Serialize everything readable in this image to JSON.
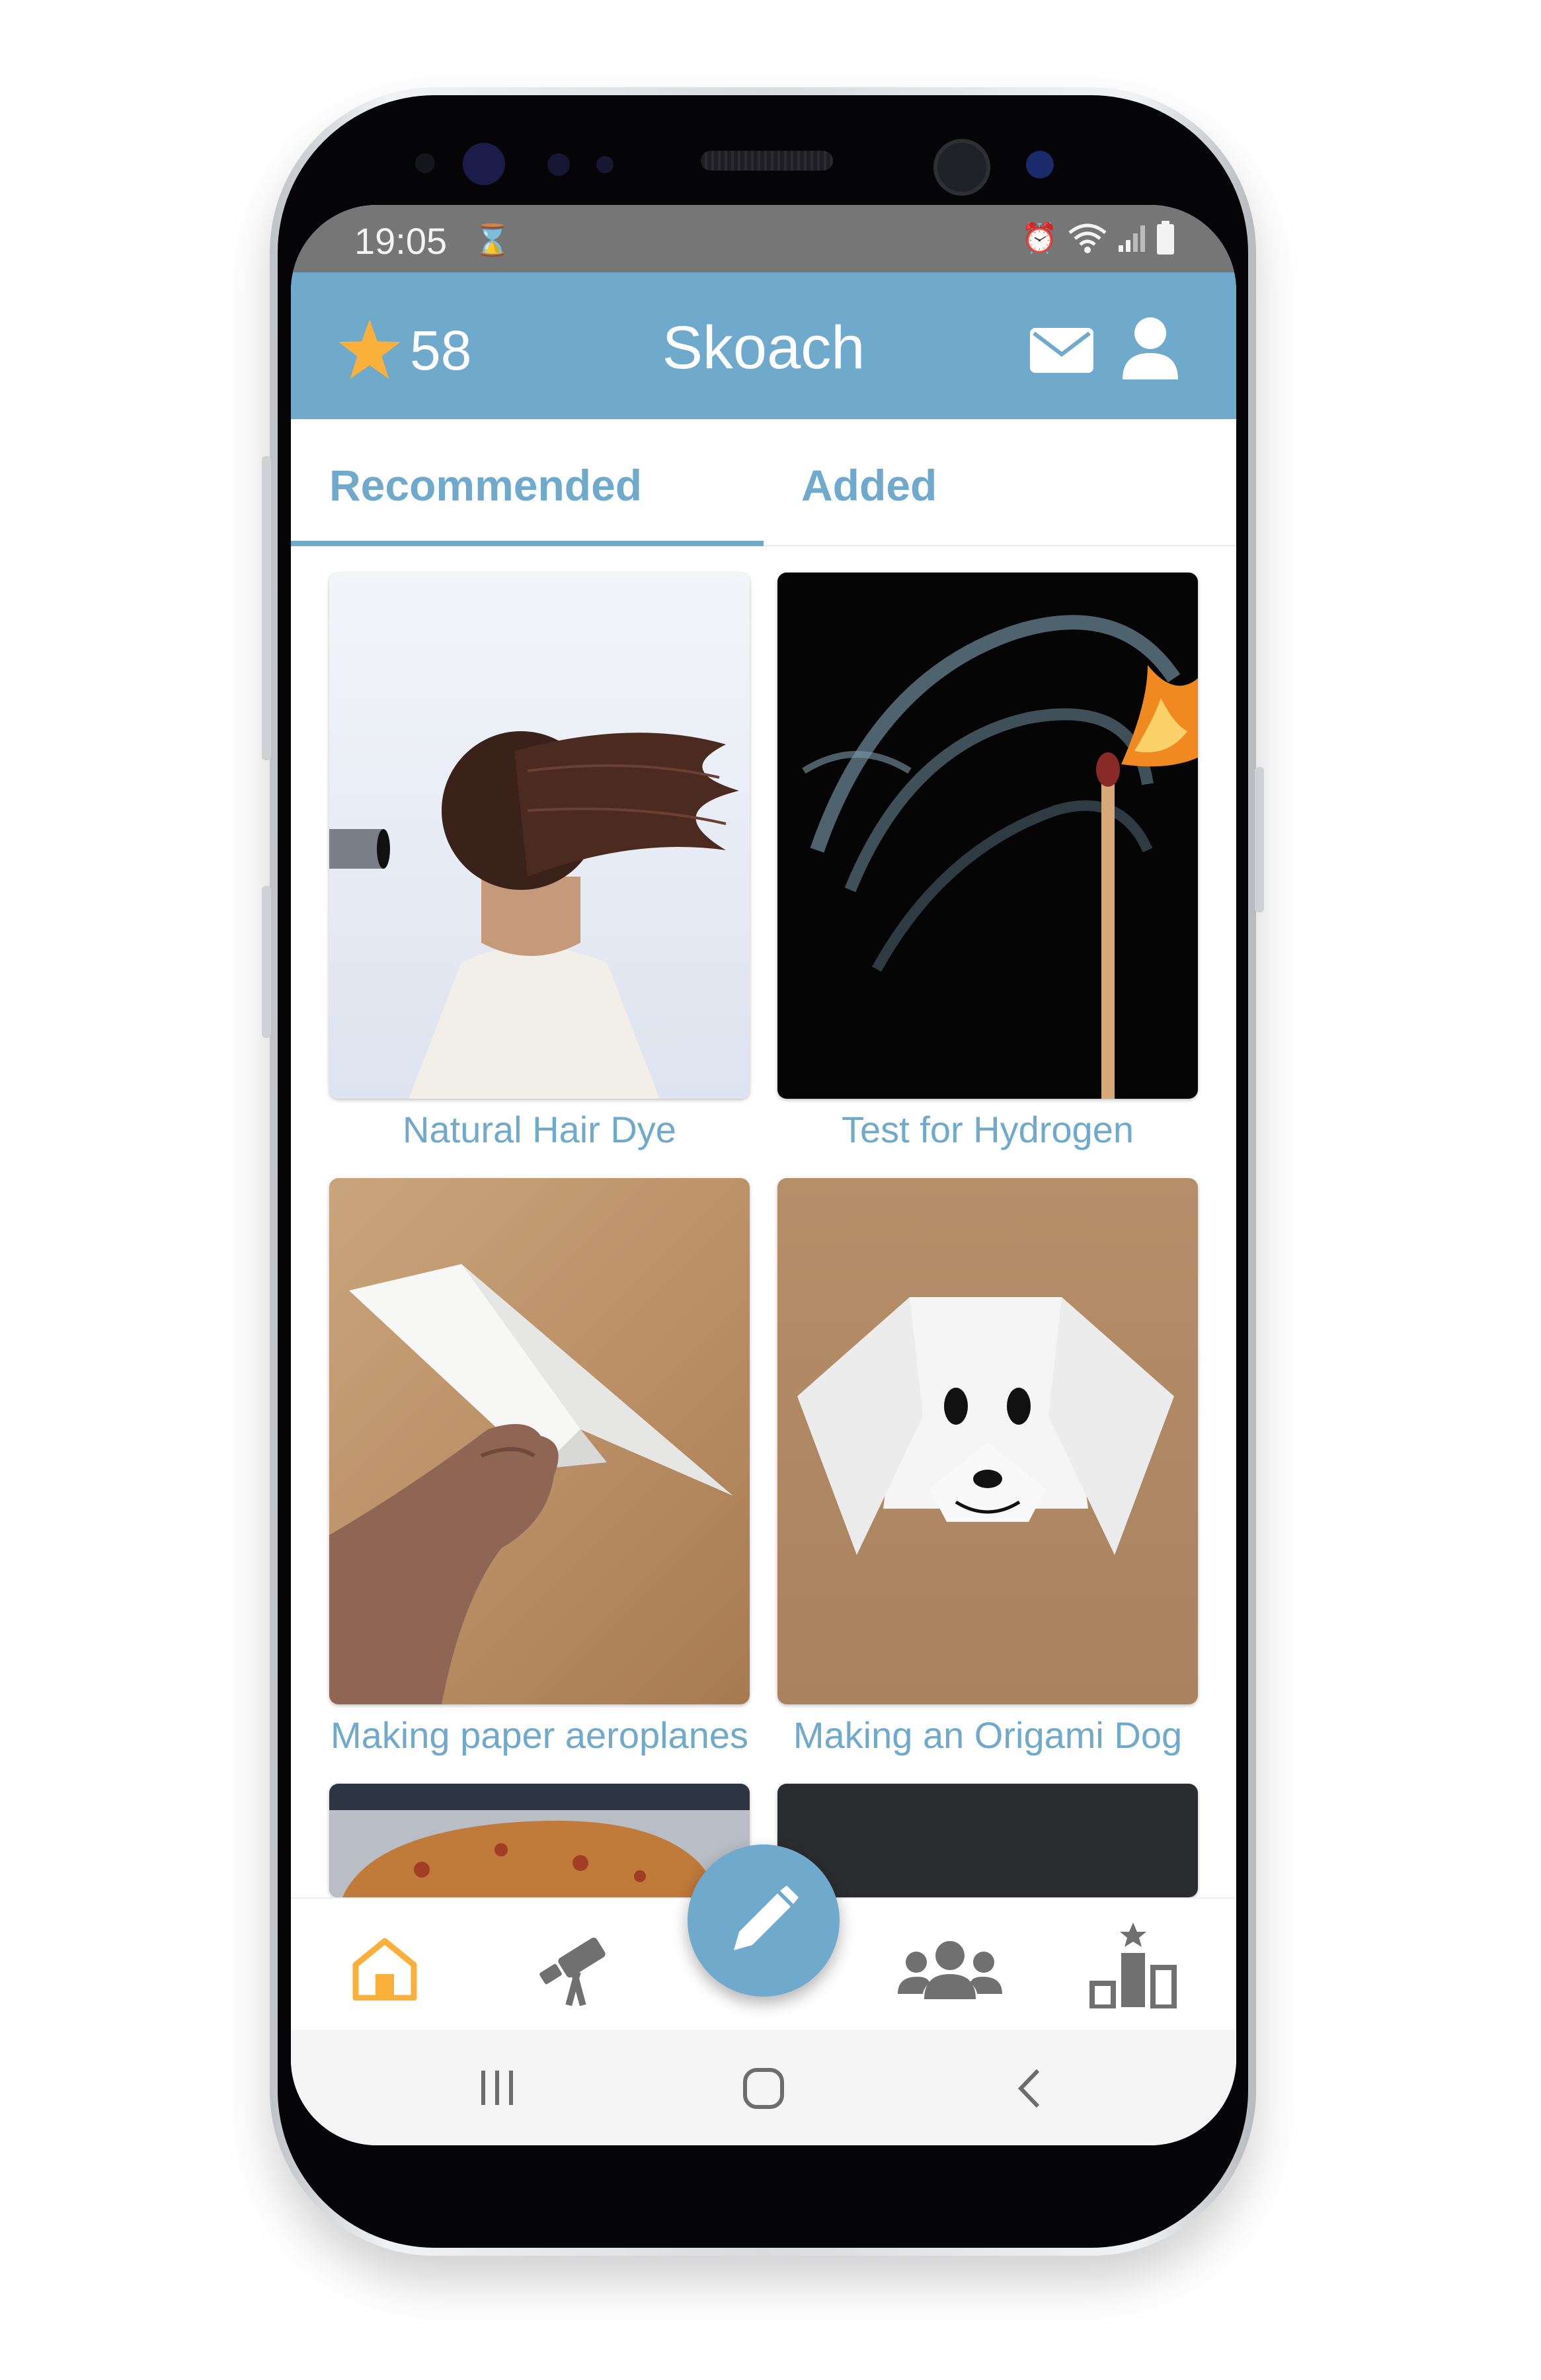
{
  "status_bar": {
    "time": "19:05",
    "hourglass_icon": "hourglass-icon",
    "right_icons": [
      "alarm-icon",
      "wifi-icon",
      "signal-icon",
      "battery-icon"
    ]
  },
  "app_bar": {
    "score": "58",
    "title": "Skoach",
    "star_icon": "star-icon",
    "mail_icon": "mail-icon",
    "profile_icon": "user-icon",
    "color": "#6fa9cb",
    "star_color": "#fbb03b"
  },
  "tabs": [
    {
      "label": "Recommended",
      "selected": true
    },
    {
      "label": "Added",
      "selected": false
    }
  ],
  "cards": [
    {
      "title": "Natural Hair Dye"
    },
    {
      "title": "Test for Hydrogen"
    },
    {
      "title": "Making paper aeroplanes"
    },
    {
      "title": "Making an Origami Dog"
    },
    {
      "title": ""
    },
    {
      "title": ""
    }
  ],
  "bottom_nav": {
    "items": [
      "home-icon",
      "telescope-icon",
      "group-icon",
      "leaderboard-icon"
    ],
    "active": "home-icon",
    "active_color": "#fbb03b",
    "fab_icon": "pencil-icon"
  },
  "system_nav": [
    "recent-apps-icon",
    "home-button-icon",
    "back-icon"
  ]
}
